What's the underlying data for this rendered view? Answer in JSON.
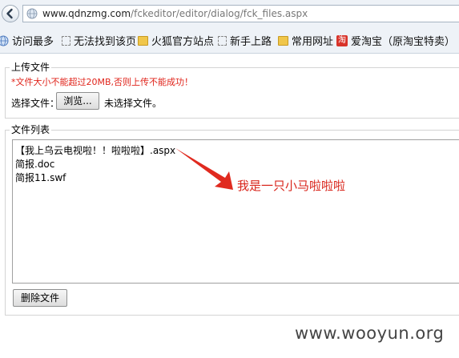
{
  "browser": {
    "url_host": "www.qdnzmg.com",
    "url_path": "/fckeditor/editor/dialog/fck_files.aspx",
    "bookmarks": [
      {
        "icon": "globe-icon",
        "label": "访问最多"
      },
      {
        "icon": "dashed-page-icon",
        "label": "无法找到该页"
      },
      {
        "icon": "folder-icon",
        "label": "火狐官方站点"
      },
      {
        "icon": "dashed-page-icon",
        "label": "新手上路"
      },
      {
        "icon": "folder-icon",
        "label": "常用网址"
      },
      {
        "icon": "taobao-icon",
        "label": "爱淘宝（原淘宝特卖）"
      }
    ],
    "taobao_icon_text": "淘"
  },
  "upload": {
    "legend": "上传文件",
    "warning": "*文件大小不能超过20MB,否则上传不能成功！",
    "choose_label": "选择文件：",
    "browse_button": "浏览...",
    "no_file_text": "未选择文件。"
  },
  "file_list": {
    "legend": "文件列表",
    "files": [
      "【我上乌云电视啦！！啦啦啦】.aspx",
      "简报.doc",
      "简报11.swf"
    ],
    "delete_button": "删除文件"
  },
  "annotation": {
    "text": "我是一只小马啦啦啦",
    "color": "#d9261c"
  },
  "watermark": "www.wooyun.org"
}
